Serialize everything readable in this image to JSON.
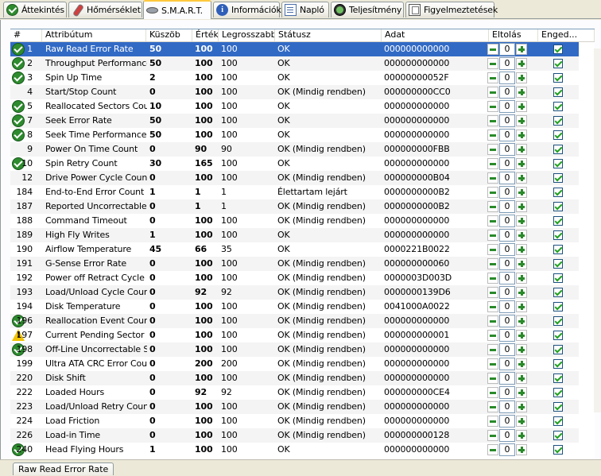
{
  "tabs": [
    {
      "label": "Áttekintés",
      "icon": "check-circle-icon"
    },
    {
      "label": "Hőmérséklet",
      "icon": "thermometer-icon"
    },
    {
      "label": "S.M.A.R.T.",
      "icon": "disk-icon"
    },
    {
      "label": "Információk",
      "icon": "info-icon"
    },
    {
      "label": "Napló",
      "icon": "log-document-icon"
    },
    {
      "label": "Teljesítmény",
      "icon": "gauge-icon"
    },
    {
      "label": "Figyelmeztetések",
      "icon": "warning-page-icon"
    }
  ],
  "active_tab": "S.M.A.R.T.",
  "columns": {
    "id": "#",
    "attr": "Attribútum",
    "thresh": "Küszöb",
    "value": "Érték",
    "worst": "Legrosszabb",
    "status": "Státusz",
    "data": "Adat",
    "offset": "Eltolás",
    "enable": "Enged..."
  },
  "rows": [
    {
      "id": "1",
      "attr": "Raw Read Error Rate",
      "thresh": "50",
      "value": "100",
      "worst": "100",
      "status": "OK",
      "data": "000000000000",
      "icon": "ok",
      "offset": "0"
    },
    {
      "id": "2",
      "attr": "Throughput Performance",
      "thresh": "50",
      "value": "100",
      "worst": "100",
      "status": "OK",
      "data": "000000000000",
      "icon": "ok",
      "offset": "0"
    },
    {
      "id": "3",
      "attr": "Spin Up Time",
      "thresh": "2",
      "value": "100",
      "worst": "100",
      "status": "OK",
      "data": "00000000052F",
      "icon": "ok",
      "offset": "0"
    },
    {
      "id": "4",
      "attr": "Start/Stop Count",
      "thresh": "0",
      "value": "100",
      "worst": "100",
      "status": "OK (Mindig rendben)",
      "data": "000000000CC0",
      "icon": "",
      "offset": "0"
    },
    {
      "id": "5",
      "attr": "Reallocated Sectors Count",
      "thresh": "10",
      "value": "100",
      "worst": "100",
      "status": "OK",
      "data": "000000000000",
      "icon": "ok",
      "offset": "0"
    },
    {
      "id": "7",
      "attr": "Seek Error Rate",
      "thresh": "50",
      "value": "100",
      "worst": "100",
      "status": "OK",
      "data": "000000000000",
      "icon": "ok",
      "offset": "0"
    },
    {
      "id": "8",
      "attr": "Seek Time Performance",
      "thresh": "50",
      "value": "100",
      "worst": "100",
      "status": "OK",
      "data": "000000000000",
      "icon": "ok",
      "offset": "0"
    },
    {
      "id": "9",
      "attr": "Power On Time Count",
      "thresh": "0",
      "value": "90",
      "worst": "90",
      "status": "OK (Mindig rendben)",
      "data": "000000000FBB",
      "icon": "",
      "offset": "0"
    },
    {
      "id": "10",
      "attr": "Spin Retry Count",
      "thresh": "30",
      "value": "165",
      "worst": "100",
      "status": "OK",
      "data": "000000000000",
      "icon": "ok",
      "offset": "0"
    },
    {
      "id": "12",
      "attr": "Drive Power Cycle Count",
      "thresh": "0",
      "value": "100",
      "worst": "100",
      "status": "OK (Mindig rendben)",
      "data": "000000000B04",
      "icon": "",
      "offset": "0"
    },
    {
      "id": "184",
      "attr": "End-to-End Error Count",
      "thresh": "1",
      "value": "1",
      "worst": "1",
      "status": "Élettartam lejárt",
      "data": "0000000000B2",
      "icon": "",
      "offset": "0"
    },
    {
      "id": "187",
      "attr": "Reported Uncorrectable ...",
      "thresh": "0",
      "value": "1",
      "worst": "1",
      "status": "OK (Mindig rendben)",
      "data": "0000000000B2",
      "icon": "",
      "offset": "0"
    },
    {
      "id": "188",
      "attr": "Command Timeout",
      "thresh": "0",
      "value": "100",
      "worst": "100",
      "status": "OK (Mindig rendben)",
      "data": "000000000000",
      "icon": "",
      "offset": "0"
    },
    {
      "id": "189",
      "attr": "High Fly Writes",
      "thresh": "1",
      "value": "100",
      "worst": "100",
      "status": "OK",
      "data": "000000000000",
      "icon": "",
      "offset": "0"
    },
    {
      "id": "190",
      "attr": "Airflow Temperature",
      "thresh": "45",
      "value": "66",
      "worst": "35",
      "status": "OK",
      "data": "0000221B0022",
      "icon": "",
      "offset": "0"
    },
    {
      "id": "191",
      "attr": "G-Sense Error Rate",
      "thresh": "0",
      "value": "100",
      "worst": "100",
      "status": "OK (Mindig rendben)",
      "data": "000000000060",
      "icon": "",
      "offset": "0"
    },
    {
      "id": "192",
      "attr": "Power off Retract Cycle ...",
      "thresh": "0",
      "value": "100",
      "worst": "100",
      "status": "OK (Mindig rendben)",
      "data": "0000003D003D",
      "icon": "",
      "offset": "0"
    },
    {
      "id": "193",
      "attr": "Load/Unload Cycle Count",
      "thresh": "0",
      "value": "92",
      "worst": "92",
      "status": "OK (Mindig rendben)",
      "data": "0000000139D6",
      "icon": "",
      "offset": "0"
    },
    {
      "id": "194",
      "attr": "Disk Temperature",
      "thresh": "0",
      "value": "100",
      "worst": "100",
      "status": "OK (Mindig rendben)",
      "data": "0041000A0022",
      "icon": "",
      "offset": "0"
    },
    {
      "id": "196",
      "attr": "Reallocation Event Count",
      "thresh": "0",
      "value": "100",
      "worst": "100",
      "status": "OK (Mindig rendben)",
      "data": "000000000000",
      "icon": "ok",
      "offset": "0"
    },
    {
      "id": "197",
      "attr": "Current Pending Sector C...",
      "thresh": "0",
      "value": "100",
      "worst": "100",
      "status": "OK (Mindig rendben)",
      "data": "000000000001",
      "icon": "warn",
      "offset": "0"
    },
    {
      "id": "198",
      "attr": "Off-Line Uncorrectable S...",
      "thresh": "0",
      "value": "100",
      "worst": "100",
      "status": "OK (Mindig rendben)",
      "data": "000000000000",
      "icon": "ok",
      "offset": "0"
    },
    {
      "id": "199",
      "attr": "Ultra ATA CRC Error Count",
      "thresh": "0",
      "value": "200",
      "worst": "200",
      "status": "OK (Mindig rendben)",
      "data": "000000000000",
      "icon": "",
      "offset": "0"
    },
    {
      "id": "220",
      "attr": "Disk Shift",
      "thresh": "0",
      "value": "100",
      "worst": "100",
      "status": "OK (Mindig rendben)",
      "data": "000000000000",
      "icon": "",
      "offset": "0"
    },
    {
      "id": "222",
      "attr": "Loaded Hours",
      "thresh": "0",
      "value": "92",
      "worst": "92",
      "status": "OK (Mindig rendben)",
      "data": "000000000CE4",
      "icon": "",
      "offset": "0"
    },
    {
      "id": "223",
      "attr": "Load/Unload Retry Count",
      "thresh": "0",
      "value": "100",
      "worst": "100",
      "status": "OK (Mindig rendben)",
      "data": "000000000000",
      "icon": "",
      "offset": "0"
    },
    {
      "id": "224",
      "attr": "Load Friction",
      "thresh": "0",
      "value": "100",
      "worst": "100",
      "status": "OK (Mindig rendben)",
      "data": "000000000000",
      "icon": "",
      "offset": "0"
    },
    {
      "id": "226",
      "attr": "Load-in Time",
      "thresh": "0",
      "value": "100",
      "worst": "100",
      "status": "OK (Mindig rendben)",
      "data": "000000000128",
      "icon": "",
      "offset": "0"
    },
    {
      "id": "240",
      "attr": "Head Flying Hours",
      "thresh": "1",
      "value": "100",
      "worst": "100",
      "status": "OK",
      "data": "000000000000",
      "icon": "ok",
      "offset": "0"
    }
  ],
  "selected_row": 0,
  "bottom_tab_label": "Raw Read Error Rate",
  "colors": {
    "selection": "#316ac5",
    "ok_icon": "#2e8b2e",
    "warn_icon": "#f2c200",
    "tab_highlight": "#ffc83c"
  }
}
